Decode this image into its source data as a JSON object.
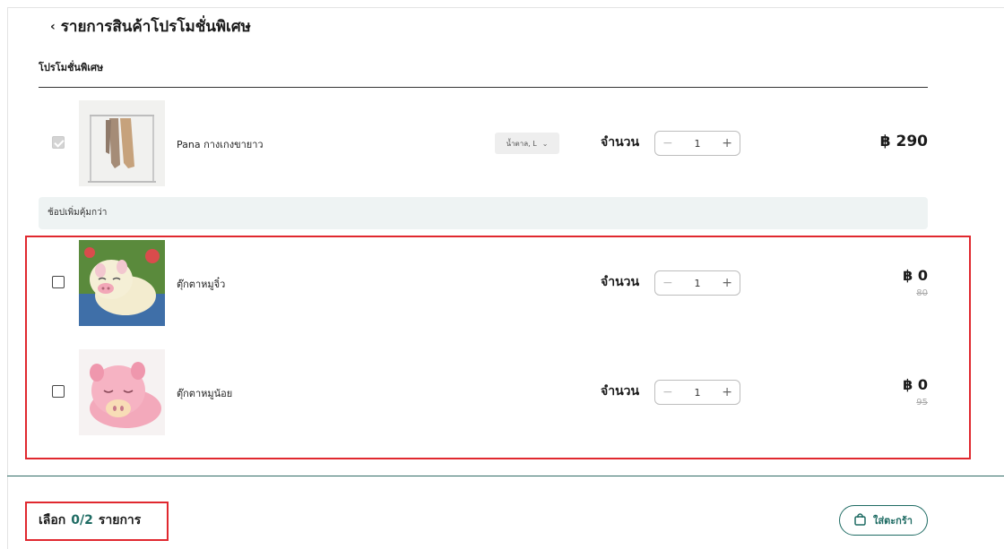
{
  "header": {
    "back_icon": "chevron-left-icon",
    "title": "รายการสินค้าโปรโมชั่นพิเศษ"
  },
  "section": {
    "label": "โปรโมชั่นพิเศษ"
  },
  "main_item": {
    "checked": true,
    "name": "Pana กางเกงขายาว",
    "variant": "น้ำตาล, L",
    "qty_label": "จำนวน",
    "quantity": "1",
    "price": "฿ 290"
  },
  "addon_bar": {
    "label": "ช้อปเพิ่มคุ้มกว่า"
  },
  "promo_items": [
    {
      "checked": false,
      "name": "ตุ๊กตาหมูจิ๋ว",
      "qty_label": "จำนวน",
      "quantity": "1",
      "price": "฿ 0",
      "original_price": "80"
    },
    {
      "checked": false,
      "name": "ตุ๊กตาหมูน้อย",
      "qty_label": "จำนวน",
      "quantity": "1",
      "price": "฿ 0",
      "original_price": "95"
    }
  ],
  "footer": {
    "select_label": "เลือก",
    "selected_count": "0/2",
    "items_label": "รายการ",
    "cart_button_label": "ใส่ตะกร้า",
    "cart_icon": "shopping-bag-icon"
  },
  "colors": {
    "accent": "#1e6b63",
    "highlight": "#e0282f",
    "addon_bg": "#eef3f3"
  }
}
